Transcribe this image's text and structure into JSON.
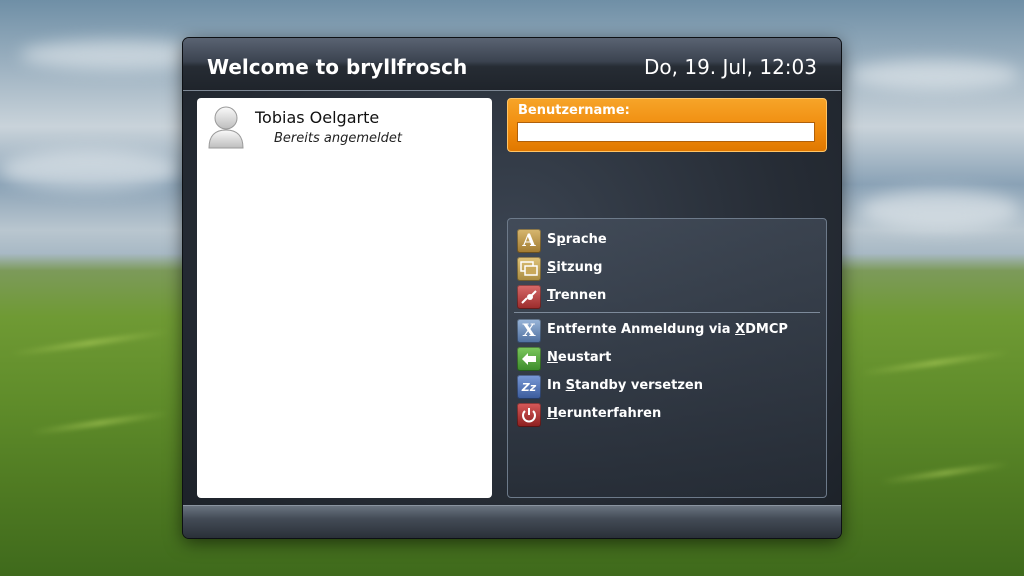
{
  "dialog": {
    "title": "Welcome to bryllfrosch",
    "clock": "Do, 19. Jul, 12:03"
  },
  "users": [
    {
      "name": "Tobias Oelgarte",
      "status": "Bereits angemeldet",
      "icon": "user-avatar-icon"
    }
  ],
  "login": {
    "label": "Benutzername:",
    "value": "",
    "placeholder": ""
  },
  "menu": {
    "items": [
      {
        "label": "Sprache",
        "accel": "p",
        "icon": "language-icon",
        "color": "#b08a3c"
      },
      {
        "label": "Sitzung",
        "accel": "S",
        "icon": "session-icon",
        "color": "#b89a52"
      },
      {
        "label": "Trennen",
        "accel": "T",
        "icon": "disconnect-icon",
        "color": "#b03c3c"
      },
      {
        "label": "Entfernte Anmeldung via XDMCP",
        "accel": "X",
        "icon": "xdmcp-icon",
        "color": "#5c7ca8"
      },
      {
        "label": "Neustart",
        "accel": "N",
        "icon": "restart-icon",
        "color": "#4e9a3a"
      },
      {
        "label": "In Standby versetzen",
        "accel": "S",
        "icon": "standby-icon",
        "color": "#4a6aa8"
      },
      {
        "label": "Herunterfahren",
        "accel": "H",
        "icon": "shutdown-icon",
        "color": "#b03030"
      }
    ]
  }
}
